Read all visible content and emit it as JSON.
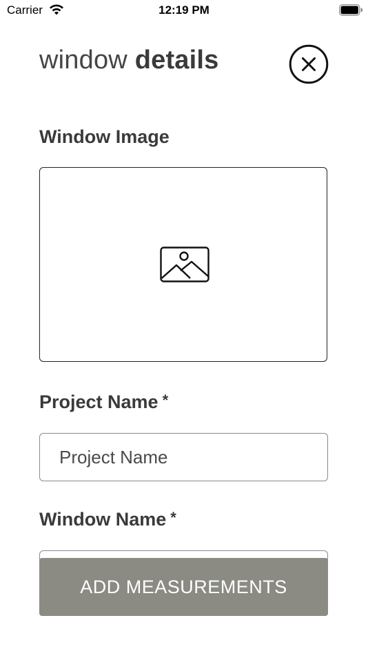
{
  "status_bar": {
    "carrier": "Carrier",
    "time": "12:19 PM",
    "icons": [
      "wifi-icon",
      "battery-icon"
    ]
  },
  "header": {
    "title_light": "window",
    "title_bold": "details",
    "close_icon": "close-icon"
  },
  "form": {
    "window_image_label": "Window Image",
    "image_placeholder_icon": "image-icon",
    "project_name_label": "Project Name",
    "project_name_required": "*",
    "project_name_placeholder": "Project Name",
    "project_name_value": "",
    "window_name_label": "Window Name",
    "window_name_required": "*",
    "window_name_value": ""
  },
  "actions": {
    "add_measurements_label": "ADD MEASUREMENTS"
  },
  "colors": {
    "text": "#3a3a3a",
    "button_bg": "#8b8b84",
    "button_text": "#ffffff",
    "border": "#8a8a8a"
  }
}
